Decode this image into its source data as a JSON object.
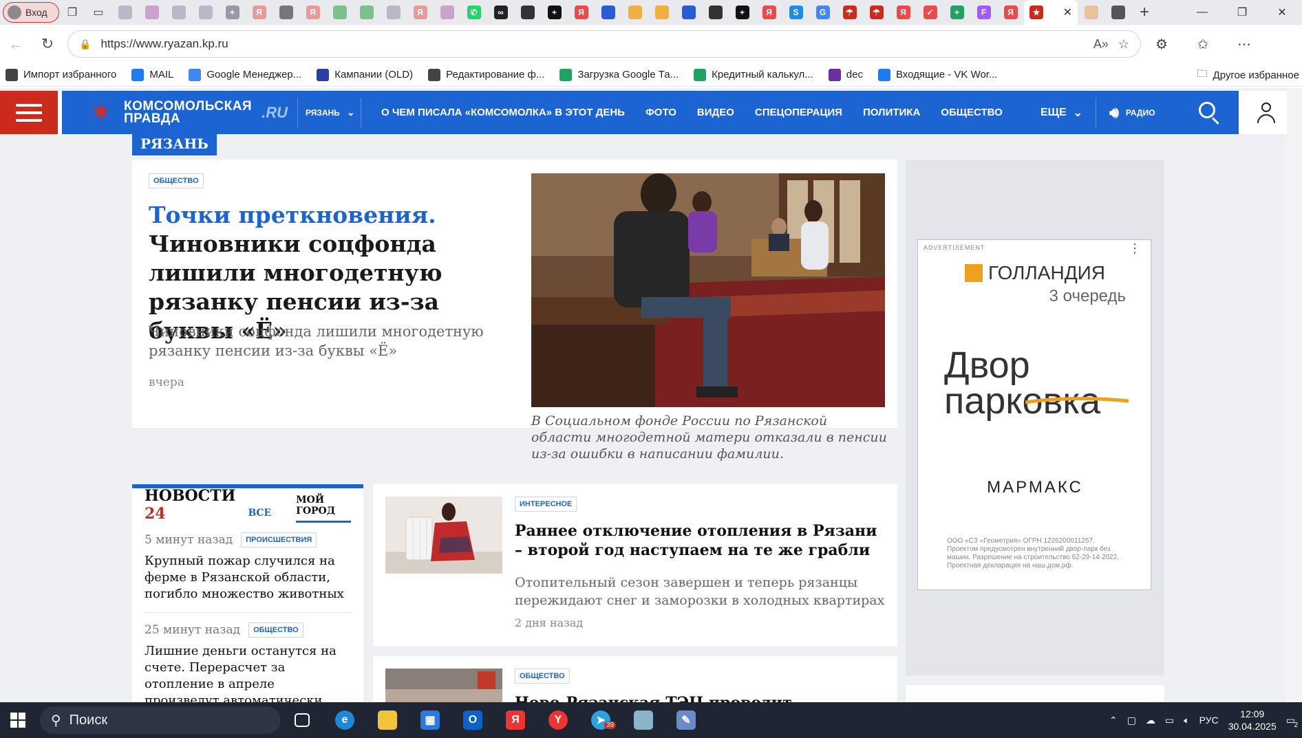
{
  "browser": {
    "profile_label": "Вход",
    "url": "https://www.ryazan.kp.ru",
    "tab_favicons": [
      {
        "glyph": "",
        "color": "#b9b9c6"
      },
      {
        "glyph": "",
        "color": "#c9a3c9"
      },
      {
        "glyph": "",
        "color": "#b9b9c6"
      },
      {
        "glyph": "",
        "color": "#b9b9c6"
      },
      {
        "glyph": "+",
        "color": "#9a9aa6"
      },
      {
        "glyph": "Я",
        "color": "#e79a9a"
      },
      {
        "glyph": "",
        "color": "#777"
      },
      {
        "glyph": "Я",
        "color": "#e79a9a"
      },
      {
        "glyph": "",
        "color": "#7cc08c"
      },
      {
        "glyph": "",
        "color": "#7cc08c"
      },
      {
        "glyph": "",
        "color": "#b9b9c6"
      },
      {
        "glyph": "Я",
        "color": "#e79a9a"
      },
      {
        "glyph": "",
        "color": "#c9a3c9"
      },
      {
        "glyph": "✆",
        "color": "#25d366"
      },
      {
        "glyph": "∞",
        "color": "#222"
      },
      {
        "glyph": "",
        "color": "#333"
      },
      {
        "glyph": "+",
        "color": "#111"
      },
      {
        "glyph": "Я",
        "color": "#e94b4b"
      },
      {
        "glyph": "",
        "color": "#2a5bd7"
      },
      {
        "glyph": "",
        "color": "#f0b040"
      },
      {
        "glyph": "",
        "color": "#f0b040"
      },
      {
        "glyph": "",
        "color": "#2a5bd7"
      },
      {
        "glyph": "",
        "color": "#333"
      },
      {
        "glyph": "+",
        "color": "#111"
      },
      {
        "glyph": "Я",
        "color": "#e94b4b"
      },
      {
        "glyph": "S",
        "color": "#1c8ee6"
      },
      {
        "glyph": "G",
        "color": "#4285f4"
      },
      {
        "glyph": "☂",
        "color": "#cc2a1b"
      },
      {
        "glyph": "☂",
        "color": "#cc2a1b"
      },
      {
        "glyph": "Я",
        "color": "#e94b4b"
      },
      {
        "glyph": "✓",
        "color": "#e94b4b"
      },
      {
        "glyph": "+",
        "color": "#1ea362"
      },
      {
        "glyph": "F",
        "color": "#a259ff"
      },
      {
        "glyph": "Я",
        "color": "#e94b4b"
      }
    ],
    "active_tab_favicon": "kp-favicon",
    "new_tab_label": "+",
    "bookmarks": [
      {
        "label": "Импорт избранного",
        "icon": "import-icon",
        "color": "#444"
      },
      {
        "label": "MAIL",
        "icon": "mail-icon",
        "color": "#1e7cf2"
      },
      {
        "label": "Google Менеджер...",
        "icon": "tag-manager-icon",
        "color": "#4285f4"
      },
      {
        "label": "Кампании (OLD)",
        "icon": "campaigns-icon",
        "color": "#2a3fa0"
      },
      {
        "label": "Редактирование ф...",
        "icon": "globe-icon",
        "color": "#444"
      },
      {
        "label": "Загрузка Google Та...",
        "icon": "drive-icon",
        "color": "#1ea362"
      },
      {
        "label": "Кредитный калькул...",
        "icon": "check-icon",
        "color": "#1ea362"
      },
      {
        "label": "dec",
        "icon": "d-icon",
        "color": "#6b2fa0"
      },
      {
        "label": "Входящие - VK Wor...",
        "icon": "vk-mail-icon",
        "color": "#1e7cf2"
      }
    ],
    "other_bookmarks": "Другое избранное"
  },
  "site": {
    "region": "РЯЗАНЬ",
    "logo_line1": "КОМСОМОЛЬСКАЯ",
    "logo_line2": "ПРАВДА",
    "logo_ru": ".RU",
    "nav": [
      "О ЧЕМ ПИСАЛА «КОМСОМОЛКА» В ЭТОТ ДЕНЬ",
      "ФОТО",
      "ВИДЕО",
      "СПЕЦОПЕРАЦИЯ",
      "ПОЛИТИКА",
      "ОБЩЕСТВО"
    ],
    "more": "ЕЩЕ",
    "radio": "РАДИО",
    "region_badge": "РЯЗАНЬ"
  },
  "hero": {
    "tag": "ОБЩЕСТВО",
    "title_highlight": "Точки преткновения.",
    "title_rest": " Чиновники соцфонда лишили многодетную рязанку пенсии из-за буквы «Ё»",
    "lead": "Чиновники соцфонда лишили многодетную рязанку пенсии из-за буквы «Ё»",
    "time": "вчера",
    "caption": "В Социальном фонде России по Рязанской области многодетной матери отказали в пенсии из-за ошибки в написании фамилии."
  },
  "news24": {
    "title": "НОВОСТИ",
    "title_num": "24",
    "tab_all": "ВСЕ",
    "tab_city": "МОЙ ГОРОД",
    "items": [
      {
        "time": "5 минут назад",
        "tag": "ПРОИСШЕСТВИЯ",
        "text": "Крупный пожар случился на ферме в Рязанской области, погибло множество животных"
      },
      {
        "time": "25 минут назад",
        "tag": "ОБЩЕСТВО",
        "text": "Лишние деньги останутся на счете. Перерасчет за отопление в апреле произведут автоматически"
      }
    ]
  },
  "articles": [
    {
      "tag": "ИНТЕРЕСНОЕ",
      "title": "Раннее отключение отопления в Рязани – второй год наступаем на те же грабли",
      "lead": "Отопительный сезон завершен и теперь рязанцы пережидают снег и заморозки в холодных квартирах",
      "when": "2 дня назад"
    },
    {
      "tag": "ОБЩЕСТВО",
      "title": "Ново-Рязанская ТЭЦ проводит открытый кон..."
    }
  ],
  "ad": {
    "label": "ADVERTISEMENT",
    "brand": "ГОЛЛАНДИЯ",
    "queue": "3 очередь",
    "line1": "Двор",
    "line2": "парковка",
    "maker": "МАРМАКС",
    "small": "ООО «СЗ «Геометрия» ОГРН 1226200011257. Проектом предусмотрен внутренний двор-парк без машин. Разрешение на строительство 62-29-14-2022. Проектная декларация на наш.дом.рф."
  },
  "taskbar": {
    "search": "Поиск",
    "lang": "РУС",
    "time": "12:09",
    "date": "30.04.2025",
    "notif": "2",
    "telegram_badge": "39"
  }
}
